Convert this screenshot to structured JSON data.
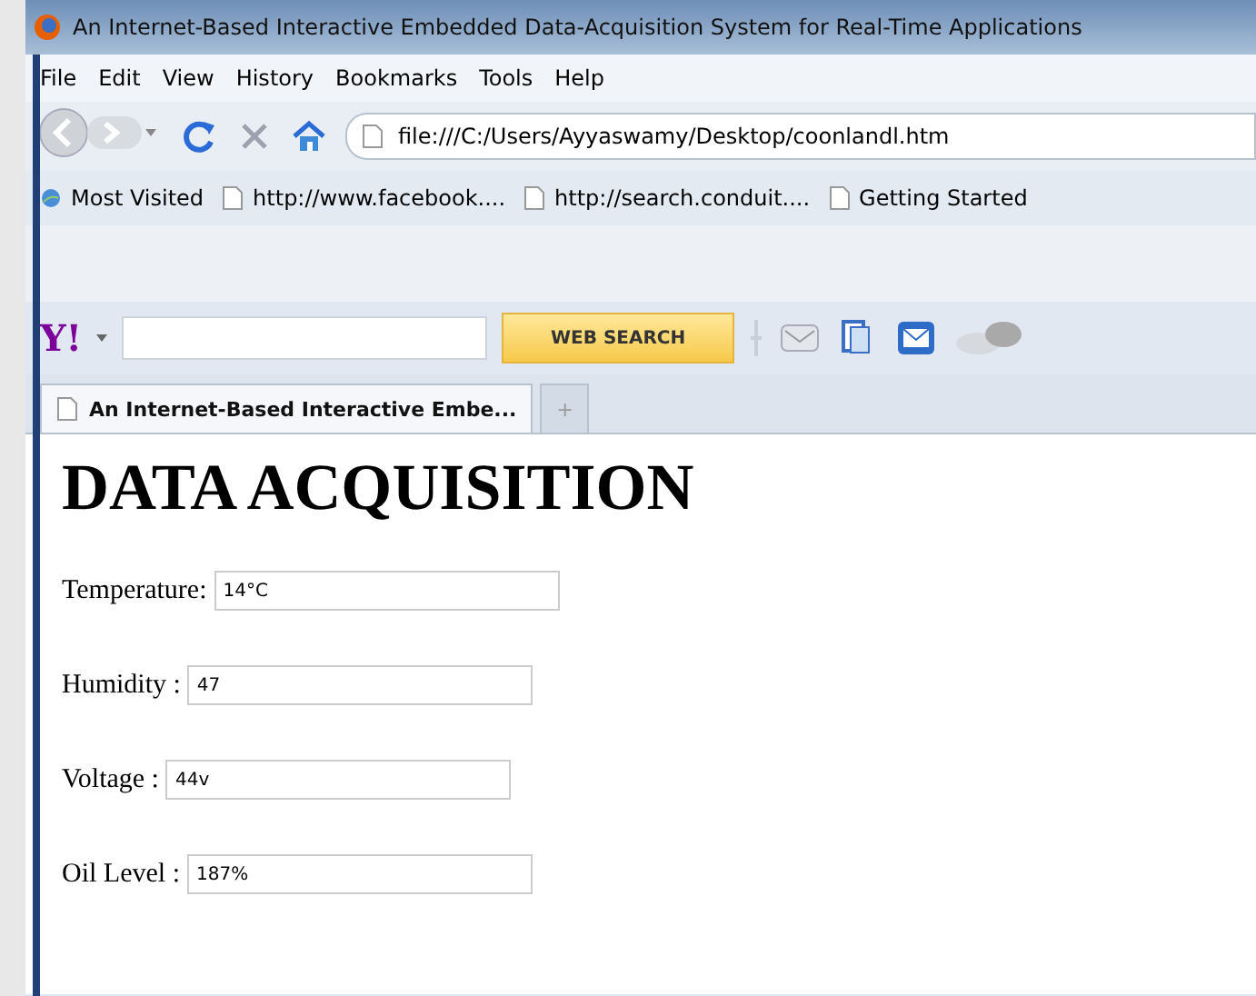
{
  "window": {
    "title": "An Internet-Based Interactive Embedded Data-Acquisition System for Real-Time Applications"
  },
  "menu": [
    "File",
    "Edit",
    "View",
    "History",
    "Bookmarks",
    "Tools",
    "Help"
  ],
  "address_bar": {
    "value": "file:///C:/Users/Ayyaswamy/Desktop/coonlandl.htm"
  },
  "bookmarks": [
    {
      "label": "Most Visited",
      "kind": "folder"
    },
    {
      "label": "http://www.facebook....",
      "kind": "page"
    },
    {
      "label": "http://search.conduit....",
      "kind": "page"
    },
    {
      "label": "Getting Started",
      "kind": "page"
    }
  ],
  "toolbar": {
    "logo": "Y!",
    "search_button": "WEB SEARCH"
  },
  "tabs": [
    {
      "label": "An Internet-Based Interactive Embe...",
      "selected": true
    },
    {
      "label": "+",
      "selected": false
    }
  ],
  "page": {
    "heading": "DATA ACQUISITION",
    "fields": [
      {
        "label": "Temperature:",
        "value": "14°C"
      },
      {
        "label": "Humidity :",
        "value": "47"
      },
      {
        "label": "Voltage :",
        "value": "44v"
      },
      {
        "label": "Oil Level :",
        "value": "187%"
      }
    ]
  }
}
